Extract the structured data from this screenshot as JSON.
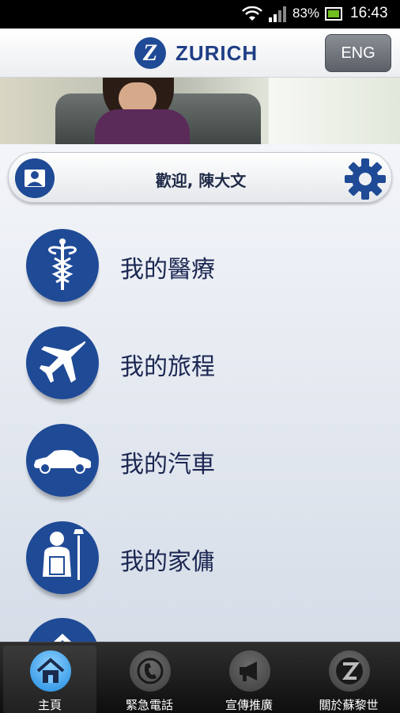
{
  "status_bar": {
    "battery_percent": "83%",
    "time": "16:43"
  },
  "header": {
    "logo_text": "ZURICH",
    "logo_mark": "Z",
    "lang_button": "ENG"
  },
  "welcome": {
    "text": "歡迎, 陳大文"
  },
  "menu": [
    {
      "label": "我的醫療",
      "icon": "caduceus-icon"
    },
    {
      "label": "我的旅程",
      "icon": "airplane-icon"
    },
    {
      "label": "我的汽車",
      "icon": "car-icon"
    },
    {
      "label": "我的家傭",
      "icon": "domestic-helper-icon"
    },
    {
      "label": "",
      "icon": "home-icon"
    }
  ],
  "tabs": [
    {
      "label": "主頁",
      "icon": "home-icon",
      "active": true
    },
    {
      "label": "緊急電話",
      "icon": "phone-icon",
      "active": false
    },
    {
      "label": "宣傳推廣",
      "icon": "megaphone-icon",
      "active": false
    },
    {
      "label": "關於蘇黎世",
      "icon": "zurich-icon",
      "active": false
    }
  ],
  "colors": {
    "brand_blue": "#1f4a96",
    "tab_active": "#1f8be0"
  }
}
